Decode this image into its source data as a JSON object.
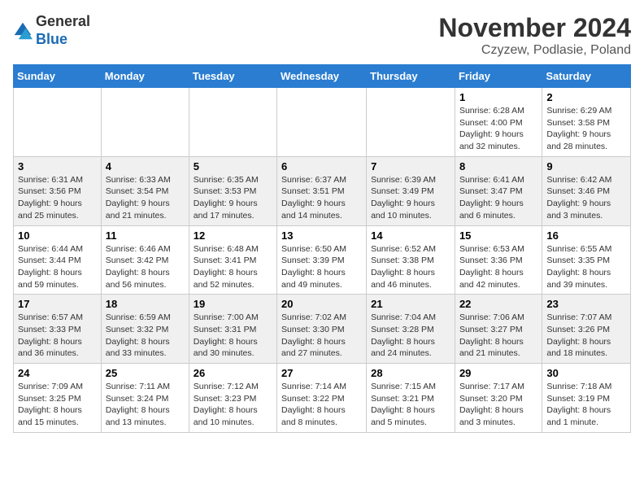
{
  "logo": {
    "general": "General",
    "blue": "Blue"
  },
  "title": "November 2024",
  "location": "Czyzew, Podlasie, Poland",
  "days_of_week": [
    "Sunday",
    "Monday",
    "Tuesday",
    "Wednesday",
    "Thursday",
    "Friday",
    "Saturday"
  ],
  "weeks": [
    [
      {
        "day": "",
        "info": ""
      },
      {
        "day": "",
        "info": ""
      },
      {
        "day": "",
        "info": ""
      },
      {
        "day": "",
        "info": ""
      },
      {
        "day": "",
        "info": ""
      },
      {
        "day": "1",
        "info": "Sunrise: 6:28 AM\nSunset: 4:00 PM\nDaylight: 9 hours and 32 minutes."
      },
      {
        "day": "2",
        "info": "Sunrise: 6:29 AM\nSunset: 3:58 PM\nDaylight: 9 hours and 28 minutes."
      }
    ],
    [
      {
        "day": "3",
        "info": "Sunrise: 6:31 AM\nSunset: 3:56 PM\nDaylight: 9 hours and 25 minutes."
      },
      {
        "day": "4",
        "info": "Sunrise: 6:33 AM\nSunset: 3:54 PM\nDaylight: 9 hours and 21 minutes."
      },
      {
        "day": "5",
        "info": "Sunrise: 6:35 AM\nSunset: 3:53 PM\nDaylight: 9 hours and 17 minutes."
      },
      {
        "day": "6",
        "info": "Sunrise: 6:37 AM\nSunset: 3:51 PM\nDaylight: 9 hours and 14 minutes."
      },
      {
        "day": "7",
        "info": "Sunrise: 6:39 AM\nSunset: 3:49 PM\nDaylight: 9 hours and 10 minutes."
      },
      {
        "day": "8",
        "info": "Sunrise: 6:41 AM\nSunset: 3:47 PM\nDaylight: 9 hours and 6 minutes."
      },
      {
        "day": "9",
        "info": "Sunrise: 6:42 AM\nSunset: 3:46 PM\nDaylight: 9 hours and 3 minutes."
      }
    ],
    [
      {
        "day": "10",
        "info": "Sunrise: 6:44 AM\nSunset: 3:44 PM\nDaylight: 8 hours and 59 minutes."
      },
      {
        "day": "11",
        "info": "Sunrise: 6:46 AM\nSunset: 3:42 PM\nDaylight: 8 hours and 56 minutes."
      },
      {
        "day": "12",
        "info": "Sunrise: 6:48 AM\nSunset: 3:41 PM\nDaylight: 8 hours and 52 minutes."
      },
      {
        "day": "13",
        "info": "Sunrise: 6:50 AM\nSunset: 3:39 PM\nDaylight: 8 hours and 49 minutes."
      },
      {
        "day": "14",
        "info": "Sunrise: 6:52 AM\nSunset: 3:38 PM\nDaylight: 8 hours and 46 minutes."
      },
      {
        "day": "15",
        "info": "Sunrise: 6:53 AM\nSunset: 3:36 PM\nDaylight: 8 hours and 42 minutes."
      },
      {
        "day": "16",
        "info": "Sunrise: 6:55 AM\nSunset: 3:35 PM\nDaylight: 8 hours and 39 minutes."
      }
    ],
    [
      {
        "day": "17",
        "info": "Sunrise: 6:57 AM\nSunset: 3:33 PM\nDaylight: 8 hours and 36 minutes."
      },
      {
        "day": "18",
        "info": "Sunrise: 6:59 AM\nSunset: 3:32 PM\nDaylight: 8 hours and 33 minutes."
      },
      {
        "day": "19",
        "info": "Sunrise: 7:00 AM\nSunset: 3:31 PM\nDaylight: 8 hours and 30 minutes."
      },
      {
        "day": "20",
        "info": "Sunrise: 7:02 AM\nSunset: 3:30 PM\nDaylight: 8 hours and 27 minutes."
      },
      {
        "day": "21",
        "info": "Sunrise: 7:04 AM\nSunset: 3:28 PM\nDaylight: 8 hours and 24 minutes."
      },
      {
        "day": "22",
        "info": "Sunrise: 7:06 AM\nSunset: 3:27 PM\nDaylight: 8 hours and 21 minutes."
      },
      {
        "day": "23",
        "info": "Sunrise: 7:07 AM\nSunset: 3:26 PM\nDaylight: 8 hours and 18 minutes."
      }
    ],
    [
      {
        "day": "24",
        "info": "Sunrise: 7:09 AM\nSunset: 3:25 PM\nDaylight: 8 hours and 15 minutes."
      },
      {
        "day": "25",
        "info": "Sunrise: 7:11 AM\nSunset: 3:24 PM\nDaylight: 8 hours and 13 minutes."
      },
      {
        "day": "26",
        "info": "Sunrise: 7:12 AM\nSunset: 3:23 PM\nDaylight: 8 hours and 10 minutes."
      },
      {
        "day": "27",
        "info": "Sunrise: 7:14 AM\nSunset: 3:22 PM\nDaylight: 8 hours and 8 minutes."
      },
      {
        "day": "28",
        "info": "Sunrise: 7:15 AM\nSunset: 3:21 PM\nDaylight: 8 hours and 5 minutes."
      },
      {
        "day": "29",
        "info": "Sunrise: 7:17 AM\nSunset: 3:20 PM\nDaylight: 8 hours and 3 minutes."
      },
      {
        "day": "30",
        "info": "Sunrise: 7:18 AM\nSunset: 3:19 PM\nDaylight: 8 hours and 1 minute."
      }
    ]
  ]
}
